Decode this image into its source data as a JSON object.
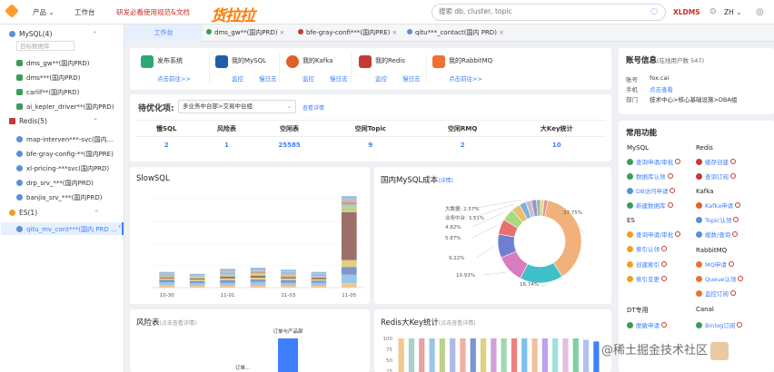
{
  "topbar": {
    "product_menu": "产品",
    "workbench": "工作台",
    "docs_link": "研发必看使用规范&文档",
    "brand": "货拉拉",
    "search_placeholder": "搜索 db, cluster, topic",
    "user": "XLDMS",
    "language": "ZH"
  },
  "sidebar": {
    "mysql_group": "MySQL(4)",
    "filter_placeholder": "目标数据库",
    "mysql_items": [
      "dms_gw**(国内PRD)",
      "dms***(国内PRD)",
      "carlif**(国内PRD)",
      "ai_kepler_driver**(国内PRD)"
    ],
    "redis_group": "Redis(5)",
    "redis_items": [
      "map-interven***-svc(国内...",
      "bfe-gray-config-**(国内PRE)",
      "xl-pricing-***svc(国内PRD)",
      "drp_srv_***(国内PRD)",
      "banjia_srv_***(国内PRD)"
    ],
    "es_group": "ES(1)",
    "es_items": [
      "qitu_mv_cont***(国内 PRD ..."
    ]
  },
  "tabs": [
    {
      "label": "工作台"
    },
    {
      "label": "dms_gw**(国内PRD)"
    },
    {
      "label": "bfe-gray-confi***(国内PRE)"
    },
    {
      "label": "qitu***_contact(国内 PRD)"
    }
  ],
  "quick_links": [
    {
      "title": "发布系统",
      "link": "点击前往>>",
      "color": "#2aa876"
    },
    {
      "title": "我的MySQL",
      "link1": "监控",
      "link2": "慢日志",
      "color": "#1f5fa8"
    },
    {
      "title": "我的Kafka",
      "link1": "监控",
      "link2": "慢日志",
      "color": "#e0602a"
    },
    {
      "title": "我的Redis",
      "link1": "监控",
      "link2": "慢日志",
      "color": "#c43b36"
    },
    {
      "title": "我的RabbitMQ",
      "link": "点击前往>>",
      "color": "#f07030"
    }
  ],
  "optimize": {
    "title": "待优化项:",
    "selected": "多业务中台部>交易中台组",
    "detail": "查看详情",
    "headers": [
      "慢SQL",
      "风险表",
      "空闲表",
      "空闲Topic",
      "空闲RMQ",
      "大Key统计"
    ],
    "values": [
      "2",
      "1",
      "25585",
      "9",
      "2",
      "10"
    ]
  },
  "slowsql": {
    "title": "SlowSQL"
  },
  "cost": {
    "title": "国内MySQL成本",
    "detail": "(详情)"
  },
  "risk": {
    "title": "风险表",
    "hint": "(点击查看详情)",
    "label1": "订单与产品部",
    "label2": "订单..."
  },
  "bigkey": {
    "title": "Redis大Key统计",
    "hint": "(点击查看详情)"
  },
  "account": {
    "title": "账号信息",
    "online": "(在线用户数 547)",
    "rows": [
      {
        "label": "账号",
        "value": "fox.cai"
      },
      {
        "label": "手机",
        "value": "点击查看"
      },
      {
        "label": "部门",
        "value": "技术中心>核心基础设施>DBA组"
      }
    ]
  },
  "functions": {
    "title": "常用功能",
    "sections": [
      {
        "name": "MySQL",
        "items": [
          "查询申请/审批",
          "数据库认领",
          "DB访问申请",
          "新建数据库"
        ]
      },
      {
        "name": "Redis",
        "items": [
          "缓存创建",
          "查询订阅"
        ]
      },
      {
        "name": "Kafka",
        "items": [
          "Kafka申请",
          "Topic认领"
        ]
      },
      {
        "name": "ES",
        "items": [
          "查询申请/审批",
          "索引认领",
          "创建索引",
          "索引变更"
        ]
      },
      {
        "name": "",
        "items": [
          "缓数/查询"
        ]
      },
      {
        "name": "RabbitMQ",
        "items": [
          "MQ申请",
          "Queue认领",
          "监控订阅"
        ]
      },
      {
        "name": "DT专用",
        "items": [
          "脱敏申请"
        ]
      },
      {
        "name": "Canal",
        "items": [
          "Binlog订阅"
        ]
      }
    ]
  },
  "watermark": "@稀土掘金技术社区",
  "chart_data": [
    {
      "type": "bar",
      "title": "SlowSQL",
      "stacked": true,
      "categories": [
        "10-30",
        "",
        "11-01",
        "",
        "11-03",
        "",
        "11-05"
      ],
      "series": [
        {
          "values": [
            6,
            5,
            5,
            6,
            5,
            5,
            12
          ]
        },
        {
          "values": [
            8,
            7,
            8,
            9,
            8,
            8,
            22
          ]
        },
        {
          "values": [
            6,
            5,
            6,
            6,
            6,
            5,
            20
          ]
        },
        {
          "values": [
            4,
            4,
            5,
            5,
            5,
            4,
            18
          ]
        },
        {
          "values": [
            3,
            3,
            5,
            5,
            4,
            4,
            125
          ]
        },
        {
          "values": [
            3,
            3,
            4,
            4,
            4,
            3,
            12
          ]
        },
        {
          "values": [
            2,
            2,
            3,
            3,
            3,
            2,
            8
          ]
        },
        {
          "values": [
            2,
            1,
            2,
            3,
            2,
            2,
            6
          ]
        },
        {
          "values": [
            3,
            2,
            4,
            4,
            4,
            3,
            6
          ]
        },
        {
          "values": [
            1,
            1,
            2,
            2,
            2,
            1,
            4
          ]
        },
        {
          "values": [
            3,
            3,
            5,
            5,
            4,
            4,
            6
          ]
        }
      ],
      "colors": [
        "#f4c790",
        "#9bc6e8",
        "#7b96d0",
        "#e0d080",
        "#9c6f6a",
        "#c0d090",
        "#a6d0c8",
        "#d8a060",
        "#b0b8e8",
        "#f0b0a0",
        "#8cc0e0"
      ],
      "ylim": [
        0,
        230
      ]
    },
    {
      "type": "pie",
      "title": "国内MySQL成本",
      "labels": [
        "大数据",
        "业务中台",
        "",
        "",
        "",
        "",
        "",
        "",
        "",
        "",
        "",
        "",
        "营..."
      ],
      "values": [
        2.57,
        3.51,
        4.82,
        5.87,
        9.22,
        10.93,
        16.74,
        37.75,
        2.2,
        2.0,
        1.6,
        1.4,
        1.4
      ],
      "display_labels": [
        "2.57%",
        "3.51%",
        "4.82%",
        "5.87%",
        "9.22%",
        "10.93%",
        "16.74%",
        "37.75%"
      ],
      "colors": [
        "#7cb0e0",
        "#e8c070",
        "#a8d880",
        "#e87070",
        "#7080d0",
        "#d87cc0",
        "#40c0c8",
        "#f2b07a",
        "#c0c0c0",
        "#a090d0",
        "#90c0a0",
        "#f0d090",
        "#e09090"
      ]
    },
    {
      "type": "bar",
      "title": "风险表",
      "categories": [
        "订单与产品部"
      ],
      "values": [
        1
      ],
      "colors": [
        "#3d7fff"
      ]
    },
    {
      "type": "bar",
      "title": "Redis大Key统计",
      "categories": [
        "",
        "",
        "",
        "",
        "",
        "",
        "",
        "",
        "",
        "",
        "",
        "",
        "",
        "",
        "",
        "",
        "",
        "",
        "",
        ""
      ],
      "values": [
        100,
        100,
        100,
        100,
        100,
        100,
        100,
        100,
        100,
        100,
        100,
        100,
        100,
        100,
        100,
        100,
        100,
        100,
        97,
        93
      ],
      "yticks": [
        "100",
        "75",
        "50",
        "25"
      ],
      "colors": [
        "#f4c790",
        "#a6d0c8",
        "#e8a0a0",
        "#9bc6e8",
        "#c0d090",
        "#b0b8e8",
        "#f0b0a0",
        "#7b96d0",
        "#e0d080",
        "#d0a0d8",
        "#a0d8b0",
        "#f08080",
        "#80c0f0",
        "#f0c0a0",
        "#c0a0f0",
        "#a0e0e0",
        "#e0c0e0",
        "#80d0a0",
        "#b0c0f0",
        "#3d7fff"
      ]
    }
  ]
}
